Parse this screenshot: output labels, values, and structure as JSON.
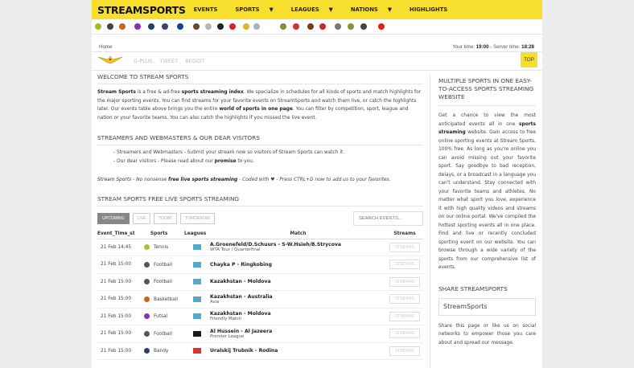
{
  "header": {
    "logo": "STREAMSPORTS",
    "nav": [
      {
        "label": "EVENTS",
        "caret": ""
      },
      {
        "label": "SPORTS",
        "caret": "▼"
      },
      {
        "label": "LEAGUES",
        "caret": "▼"
      },
      {
        "label": "NATIONS",
        "caret": "▼"
      },
      {
        "label": "HIGHLIGHTS",
        "caret": ""
      }
    ]
  },
  "sport_icons": [
    {
      "name": "tennis-ball-icon",
      "color": "#9cbe2a"
    },
    {
      "name": "soccer-ball-icon",
      "color": "#444"
    },
    {
      "name": "basketball-icon",
      "color": "#c8651a"
    },
    {
      "name": "futsal-icon",
      "color": "#8a2db0"
    },
    {
      "name": "bandy-icon",
      "color": "#2b3f66"
    },
    {
      "name": "ice-hockey-icon",
      "color": "#3a4a5a"
    },
    {
      "name": "motorsport-icon",
      "color": "#1a3d8a"
    },
    {
      "name": "rugby-icon",
      "color": "#6b4a2a"
    },
    {
      "name": "cricket-icon",
      "color": "#b6b6b6"
    },
    {
      "name": "boxing-icon",
      "color": "#222"
    },
    {
      "name": "ufc-icon",
      "color": "#d22"
    },
    {
      "name": "volleyball-icon",
      "color": "#d8b63a"
    },
    {
      "name": "handball-icon",
      "color": "#9bb5cc"
    },
    {
      "name": "badminton-icon",
      "color": "#8a8a3a"
    },
    {
      "name": "table-tennis-icon",
      "color": "#c33"
    },
    {
      "name": "american-football-icon",
      "color": "#7a3a1a"
    },
    {
      "name": "snooker-icon",
      "color": "#c52a2a"
    },
    {
      "name": "darts-icon",
      "color": "#777"
    },
    {
      "name": "hockey-stick-icon",
      "color": "#7a9a3a"
    },
    {
      "name": "golf-icon",
      "color": "#444"
    },
    {
      "name": "cherry-icon",
      "color": "#d21"
    }
  ],
  "breadcrumb": "Home",
  "time": {
    "your_label": "Your time:",
    "your_value": "19:00",
    "server_label": "- Server time:",
    "server_value": "18:28"
  },
  "social": [
    "G-PLUS",
    "TWEET",
    "REDDIT"
  ],
  "top_button": "TOP",
  "welcome": {
    "title": "WELCOME TO STREAM SPORTS",
    "brand": "Stream Sports",
    "t1": " is a free & ad-free ",
    "b1": "sports streaming index",
    "t2": ". We specialize in schedules for all kinds of sports and match highlights for the major sporting events. You can find streams for your favorite events on StreamSports and watch them live, or catch the highlights later. Our events table above brings you the entire ",
    "b2": "world of sports in one page",
    "t3": ". You can filter by competition, sport, league and nation or your favorite teams. You can also catch the highlights if you missed the live event."
  },
  "streamers": {
    "title": "STREAMERS AND WEBMASTERS & OUR DEAR VISITORS",
    "line1": "- Streamers and Webmasters - Submit your stream now so visitors of Stream Sports can watch it.",
    "line2a": "- Our dear visitors - Please read about our ",
    "line2b": "promise",
    "line2c": " to you."
  },
  "tagline": {
    "a": "Stream Sports",
    "b": " - No nonsense ",
    "c": "free live sports streaming",
    "d": " - Coded with ♥ - Press CTRL+D now to add us to your favorites."
  },
  "schedule": {
    "title": "STREAM SPORTS FREE LIVE SPORTS STREAMING",
    "filters": [
      "UPCOMING",
      "LIVE",
      "TODAY",
      "TOMORROW"
    ],
    "search_placeholder": "SEARCH EVENTS...",
    "columns": [
      "Event_Time_st",
      "Sports",
      "Leagues",
      "Match",
      "Streams"
    ],
    "rows": [
      {
        "time": "21 Feb 14:45",
        "sport": "Tennis",
        "sport_color": "#a9c23a",
        "league_color": "#5aa8c8",
        "league_icon": "global-league-icon",
        "match": "A.Groenefeld/D.Schuurs - S-W.Hsieh/B.Strycova",
        "sub": "WTA Tour / Quarterfinal",
        "stream": "STREAMS"
      },
      {
        "time": "21 Feb 15:00",
        "sport": "Football",
        "sport_color": "#555",
        "league_color": "#5aa8c8",
        "league_icon": "global-league-icon",
        "match": "Chayka P - Ringkobing",
        "sub": "",
        "stream": "STREAMS"
      },
      {
        "time": "21 Feb 15:00",
        "sport": "Football",
        "sport_color": "#555",
        "league_color": "#5aa8c8",
        "league_icon": "global-league-icon",
        "match": "Kazakhstan - Moldova",
        "sub": "",
        "stream": "STREAMS"
      },
      {
        "time": "21 Feb 15:00",
        "sport": "Basketball",
        "sport_color": "#c8651a",
        "league_color": "#5aa8c8",
        "league_icon": "global-league-icon",
        "match": "Kazakhstan - Australia",
        "sub": "Asia",
        "stream": "STREAMS"
      },
      {
        "time": "21 Feb 15:00",
        "sport": "Futsal",
        "sport_color": "#8a2db0",
        "league_color": "#5aa8c8",
        "league_icon": "global-league-icon",
        "match": "Kazakhstan - Moldova",
        "sub": "Friendly Match",
        "stream": "STREAMS"
      },
      {
        "time": "21 Feb 15:00",
        "sport": "Football",
        "sport_color": "#555",
        "league_color": "#1a1a1a",
        "league_icon": "jordan-flag-icon",
        "match": "Al Hussein - Al Jazeera",
        "sub": "Premier League",
        "stream": "STREAMS"
      },
      {
        "time": "21 Feb 15:00",
        "sport": "Bandy",
        "sport_color": "#2b3f66",
        "league_color": "#d33",
        "league_icon": "russia-flag-icon",
        "match": "Uralskij Trubnik - Rodina",
        "sub": "",
        "stream": "STREAMS"
      }
    ]
  },
  "sidebar": {
    "title": "MULTIPLE SPORTS IN ONE EASY-TO-ACCESS SPORTS STREAMING WEBSITE",
    "p_a": "Get a chance to view the most anticipated events all in one ",
    "p_b": "sports streaming",
    "p_c": " website. Gain access to free online sporting events at Stream Sports, 100% free. As long as you're online you can avoid missing out your favorite sport. Say goodbye to bad reception, delays, or a broadcast in a language you can't understand. Stay connected with your favorite teams and athletes. No matter what sport you love, experience it with high quality videos and streams on our online portal. We've compiled the hottest sporting events all in one place. Find and live or recently concluded sporting event on our website. You can browse through a wide variety of the sports from our comprehensive list of events.",
    "share_title": "SHARE STREAMSPORTS",
    "share_box": "StreamSports",
    "share_text": "Share this page or like us on social networks to empower those you care about and spread our message."
  }
}
